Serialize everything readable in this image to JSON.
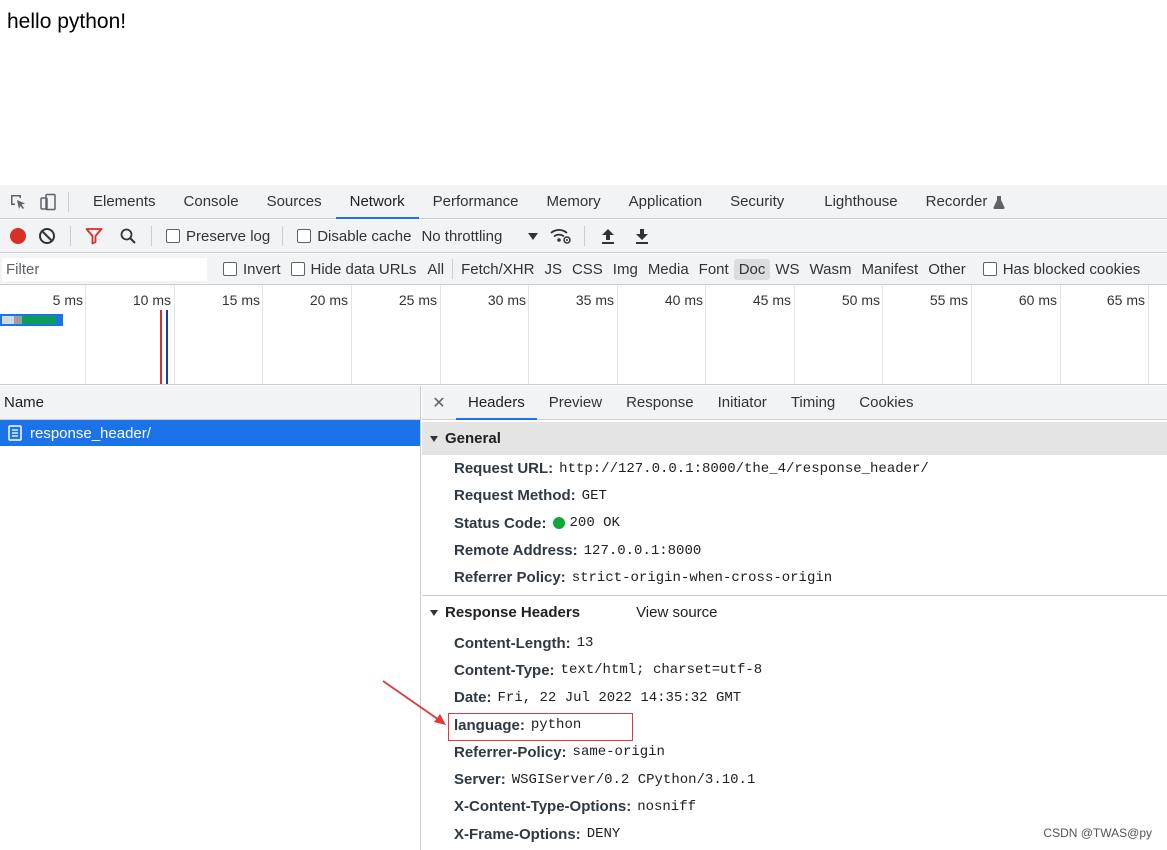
{
  "page": {
    "text": "hello python!"
  },
  "main_tabs": {
    "items": [
      {
        "label": "Elements",
        "active": false
      },
      {
        "label": "Console",
        "active": false
      },
      {
        "label": "Sources",
        "active": false
      },
      {
        "label": "Network",
        "active": true
      },
      {
        "label": "Performance",
        "active": false
      },
      {
        "label": "Memory",
        "active": false
      },
      {
        "label": "Application",
        "active": false
      },
      {
        "label": "Security",
        "active": false
      },
      {
        "label": "Lighthouse",
        "active": false
      },
      {
        "label": "Recorder",
        "active": false
      }
    ]
  },
  "toolbar": {
    "preserve_log": "Preserve log",
    "disable_cache": "Disable cache",
    "throttling": "No throttling"
  },
  "filter": {
    "placeholder": "Filter",
    "invert": "Invert",
    "hide_data_urls": "Hide data URLs",
    "types": [
      {
        "label": "All",
        "active": false
      },
      {
        "label": "Fetch/XHR",
        "active": false
      },
      {
        "label": "JS",
        "active": false
      },
      {
        "label": "CSS",
        "active": false
      },
      {
        "label": "Img",
        "active": false
      },
      {
        "label": "Media",
        "active": false
      },
      {
        "label": "Font",
        "active": false
      },
      {
        "label": "Doc",
        "active": true
      },
      {
        "label": "WS",
        "active": false
      },
      {
        "label": "Wasm",
        "active": false
      },
      {
        "label": "Manifest",
        "active": false
      },
      {
        "label": "Other",
        "active": false
      }
    ],
    "has_blocked_cookies": "Has blocked cookies"
  },
  "overview": {
    "ticks": [
      "5 ms",
      "10 ms",
      "15 ms",
      "20 ms",
      "25 ms",
      "30 ms",
      "35 ms",
      "40 ms",
      "45 ms",
      "50 ms",
      "55 ms",
      "60 ms",
      "65 ms"
    ]
  },
  "requests": {
    "column_name": "Name",
    "rows": [
      {
        "name": "response_header/"
      }
    ]
  },
  "detail_tabs": {
    "items": [
      {
        "label": "Headers",
        "active": true
      },
      {
        "label": "Preview",
        "active": false
      },
      {
        "label": "Response",
        "active": false
      },
      {
        "label": "Initiator",
        "active": false
      },
      {
        "label": "Timing",
        "active": false
      },
      {
        "label": "Cookies",
        "active": false
      }
    ]
  },
  "general": {
    "title": "General",
    "request_url": {
      "key": "Request URL:",
      "value": "http://127.0.0.1:8000/the_4/response_header/"
    },
    "request_method": {
      "key": "Request Method:",
      "value": "GET"
    },
    "status_code": {
      "key": "Status Code:",
      "value": "200 OK"
    },
    "remote_address": {
      "key": "Remote Address:",
      "value": "127.0.0.1:8000"
    },
    "referrer_policy": {
      "key": "Referrer Policy:",
      "value": "strict-origin-when-cross-origin"
    }
  },
  "response_headers": {
    "title": "Response Headers",
    "view_source": "View source",
    "items": [
      {
        "key": "Content-Length:",
        "value": "13"
      },
      {
        "key": "Content-Type:",
        "value": "text/html; charset=utf-8"
      },
      {
        "key": "Date:",
        "value": "Fri, 22 Jul 2022 14:35:32 GMT"
      },
      {
        "key": "language:",
        "value": "python"
      },
      {
        "key": "Referrer-Policy:",
        "value": "same-origin"
      },
      {
        "key": "Server:",
        "value": "WSGIServer/0.2 CPython/3.10.1"
      },
      {
        "key": "X-Content-Type-Options:",
        "value": "nosniff"
      },
      {
        "key": "X-Frame-Options:",
        "value": "DENY"
      }
    ]
  },
  "watermark": "CSDN @TWAS@py"
}
